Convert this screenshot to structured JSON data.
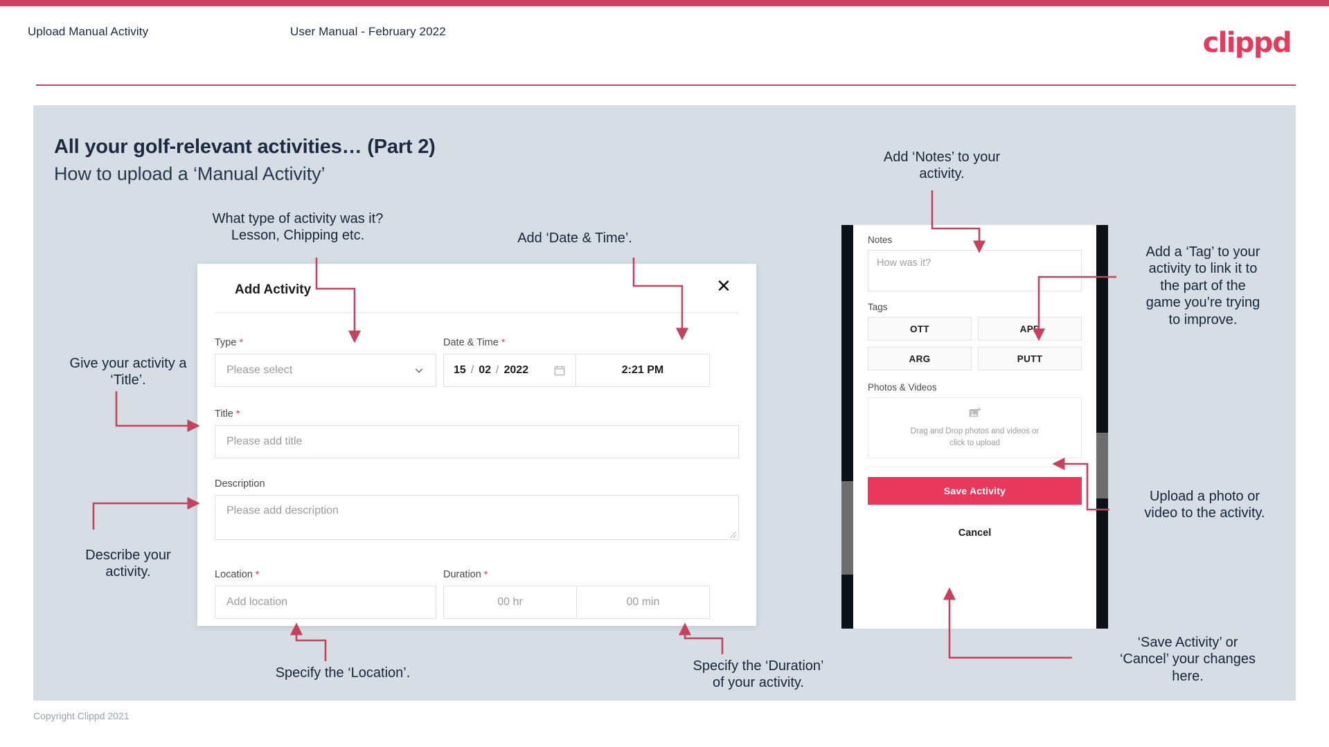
{
  "header": {
    "left_title": "Upload Manual Activity",
    "center_title": "User Manual - February 2022",
    "logo_text": "clippd"
  },
  "slide": {
    "title": "All your golf-relevant activities… (Part 2)",
    "subtitle": "How to upload a ‘Manual Activity’"
  },
  "footer": {
    "copyright": "Copyright Clippd 2021"
  },
  "dialog": {
    "title": "Add Activity",
    "close_icon": "close-icon",
    "fields": {
      "type": {
        "label": "Type",
        "required_mark": "*",
        "placeholder": "Please select",
        "chevron_icon": "chevron-down-icon"
      },
      "datetime": {
        "label": "Date & Time",
        "required_mark": "*",
        "day": "15",
        "sep1": "/",
        "month": "02",
        "sep2": "/",
        "year": "2022",
        "calendar_icon": "calendar-icon",
        "time": "2:21 PM"
      },
      "title": {
        "label": "Title",
        "required_mark": "*",
        "placeholder": "Please add title"
      },
      "description": {
        "label": "Description",
        "placeholder": "Please add description"
      },
      "location": {
        "label": "Location",
        "required_mark": "*",
        "placeholder": "Add location"
      },
      "duration": {
        "label": "Duration",
        "required_mark": "*",
        "hours_placeholder": "00 hr",
        "minutes_placeholder": "00 min"
      }
    }
  },
  "phone": {
    "notes": {
      "label": "Notes",
      "placeholder": "How was it?"
    },
    "tags": {
      "label": "Tags",
      "items": [
        "OTT",
        "APP",
        "ARG",
        "PUTT"
      ]
    },
    "media": {
      "label": "Photos & Videos",
      "icon": "add-image-icon",
      "line1": "Drag and Drop photos and videos or",
      "line2": "click to upload"
    },
    "save_label": "Save Activity",
    "cancel_label": "Cancel"
  },
  "annotations": {
    "type": "What type of activity was it?\nLesson, Chipping etc.",
    "datetime": "Add ‘Date & Time’.",
    "title": "Give your activity a\n‘Title’.",
    "description": "Describe your\nactivity.",
    "location": "Specify the ‘Location’.",
    "duration": "Specify the ‘Duration’\nof your activity.",
    "notes": "Add ‘Notes’ to your\nactivity.",
    "tags": "Add a ‘Tag’ to your\nactivity to link it to\nthe part of the\ngame you’re trying\nto improve.",
    "media": "Upload a photo or\nvideo to the activity.",
    "save": "‘Save Activity’ or\n‘Cancel’ your changes\nhere."
  },
  "colors": {
    "brand_pink": "#e8385c",
    "arrow_red": "#c4425c",
    "slide_bg": "#d7dde5",
    "ink": "#15243b"
  }
}
